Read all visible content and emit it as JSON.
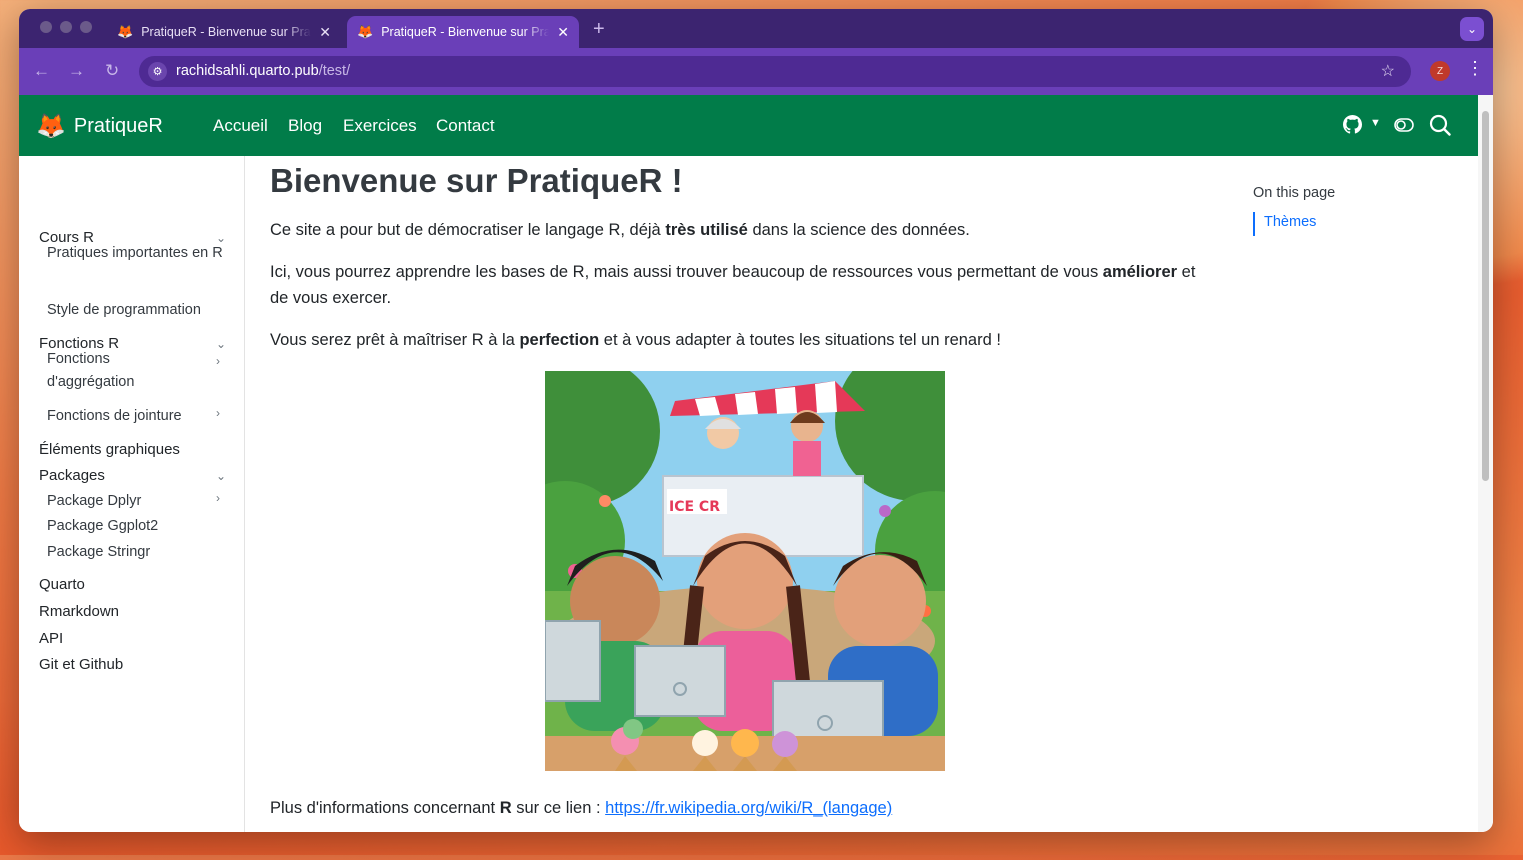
{
  "browser": {
    "tabs": [
      {
        "title": "PratiqueR - Bienvenue sur PratiqueR",
        "active": false
      },
      {
        "title": "PratiqueR - Bienvenue sur PratiqueR",
        "active": true
      }
    ],
    "url_host": "rachidsahli.quarto.pub",
    "url_path": "/test/",
    "profile_initial": "Z"
  },
  "site": {
    "brand": "PratiqueR",
    "nav": [
      "Accueil",
      "Blog",
      "Exercices",
      "Contact"
    ],
    "colors": {
      "navbar": "#017c49",
      "link": "#0d6efd"
    }
  },
  "sidebar": {
    "sections": [
      {
        "label": "Cours R",
        "expanded": true,
        "items": [
          {
            "label": "Pratiques importantes en R"
          },
          {
            "label": "Style de programmation"
          }
        ]
      },
      {
        "label": "Fonctions R",
        "expanded": true,
        "items": [
          {
            "label": "Fonctions d'aggrégation"
          },
          {
            "label": "Fonctions de jointure"
          }
        ]
      },
      {
        "label": "Éléments graphiques"
      },
      {
        "label": "Packages",
        "expanded": true,
        "items": [
          {
            "label": "Package Dplyr"
          },
          {
            "label": "Package Ggplot2"
          },
          {
            "label": "Package Stringr"
          }
        ]
      },
      {
        "label": "Quarto"
      },
      {
        "label": "Rmarkdown"
      },
      {
        "label": "API"
      },
      {
        "label": "Git et Github"
      }
    ]
  },
  "main": {
    "title": "Bienvenue sur PratiqueR !",
    "p1": {
      "a": "Ce site a pour but de démocratiser le langage R, déjà ",
      "b": "très utilisé",
      "c": " dans la science des données."
    },
    "p2": {
      "a": "Ici, vous pourrez apprendre les bases de R, mais aussi trouver beaucoup de ressources vous permettant de vous ",
      "b": "améliorer",
      "c": " et de vous exercer."
    },
    "p3": {
      "a": "Vous serez prêt à maîtriser R à la ",
      "b": "perfection",
      "c": " et à vous adapter à toutes les situations tel un renard !"
    },
    "illustration_sign": "ICE CR",
    "p4": {
      "a": "Plus d'informations concernant ",
      "b": "R",
      "c": " sur ce lien : ",
      "link": "https://fr.wikipedia.org/wiki/R_(langage)"
    }
  },
  "toc": {
    "title": "On this page",
    "items": [
      "Thèmes"
    ]
  }
}
